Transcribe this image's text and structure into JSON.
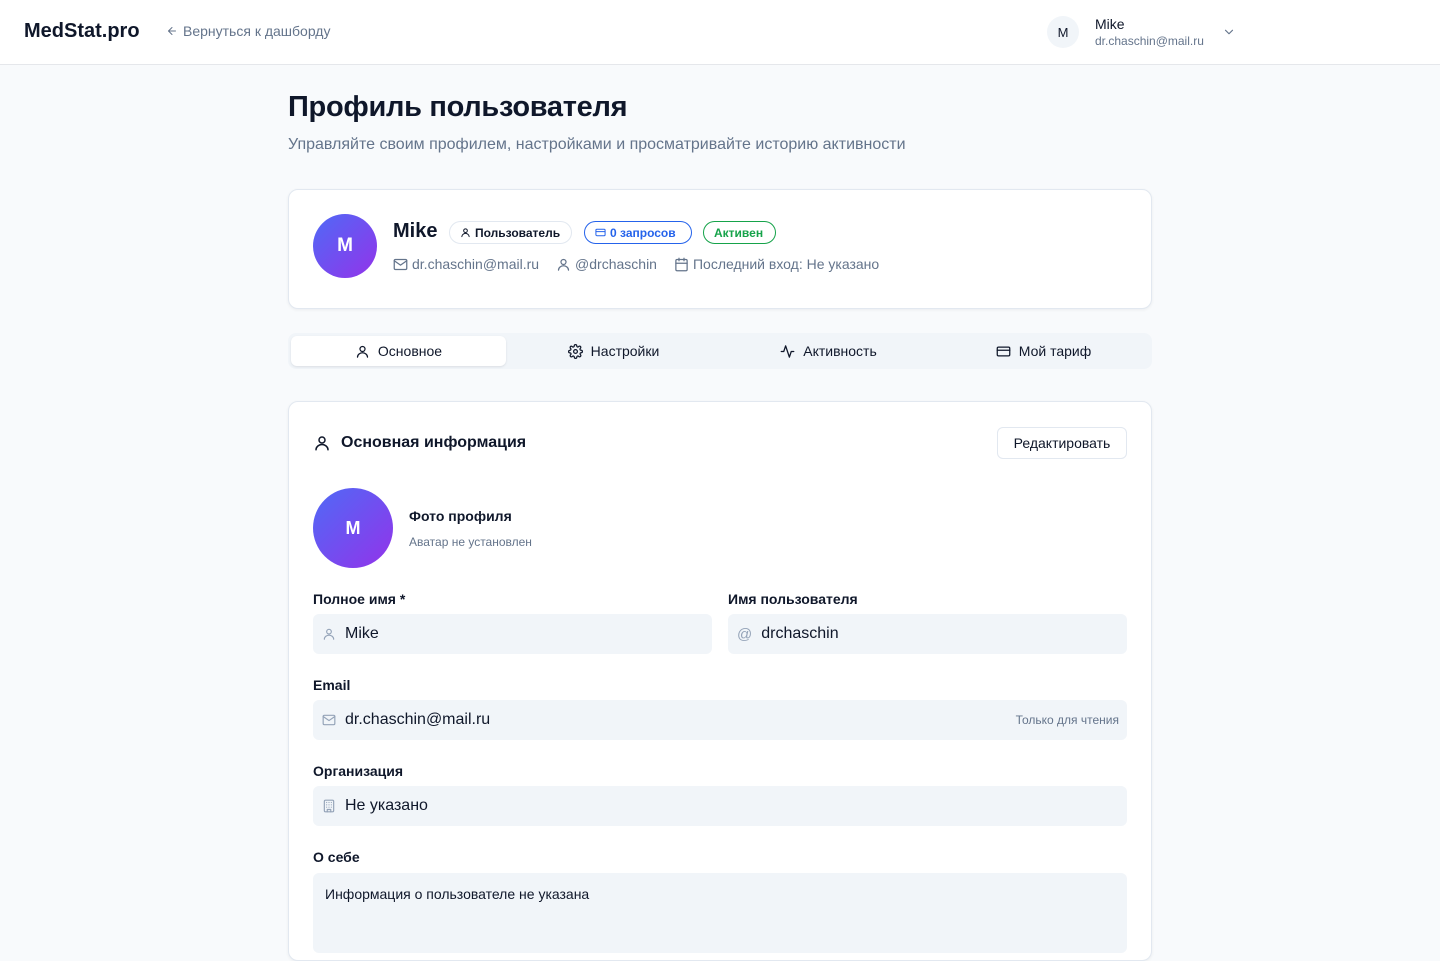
{
  "header": {
    "brand": "MedStat.pro",
    "back_link": "Вернуться к дашборду",
    "user_initial": "M",
    "user_name": "Mike",
    "user_email": "dr.chaschin@mail.ru"
  },
  "page": {
    "title": "Профиль пользователя",
    "subtitle": "Управляйте своим профилем, настройками и просматривайте историю активности"
  },
  "profile": {
    "initial": "M",
    "name": "Mike",
    "badges": {
      "role": "Пользователь",
      "requests": "0 запросов",
      "status": "Активен"
    },
    "email": "dr.chaschin@mail.ru",
    "username": "@drchaschin",
    "last_login": "Последний вход: Не указано"
  },
  "tabs": [
    {
      "label": "Основное",
      "icon": "user-icon",
      "active": true
    },
    {
      "label": "Настройки",
      "icon": "gear-icon",
      "active": false
    },
    {
      "label": "Активность",
      "icon": "activity-icon",
      "active": false
    },
    {
      "label": "Мой тариф",
      "icon": "credit-card-icon",
      "active": false
    }
  ],
  "basic_info": {
    "title": "Основная информация",
    "edit_button": "Редактировать",
    "photo": {
      "initial": "M",
      "title": "Фото профиля",
      "subtitle": "Аватар не установлен"
    },
    "full_name": {
      "label": "Полное имя *",
      "value": "Mike"
    },
    "username": {
      "label": "Имя пользователя",
      "prefix": "@",
      "value": "drchaschin"
    },
    "email": {
      "label": "Email",
      "value": "dr.chaschin@mail.ru",
      "readonly_tag": "Только для чтения"
    },
    "organization": {
      "label": "Организация",
      "value": "Не указано"
    },
    "about": {
      "label": "О себе",
      "value": "Информация о пользователе не указана"
    }
  },
  "colors": {
    "accent_blue": "#2563eb",
    "active_green": "#16a34a",
    "avatar_gradient_start": "#4f6af6",
    "avatar_gradient_end": "#9333ea"
  }
}
